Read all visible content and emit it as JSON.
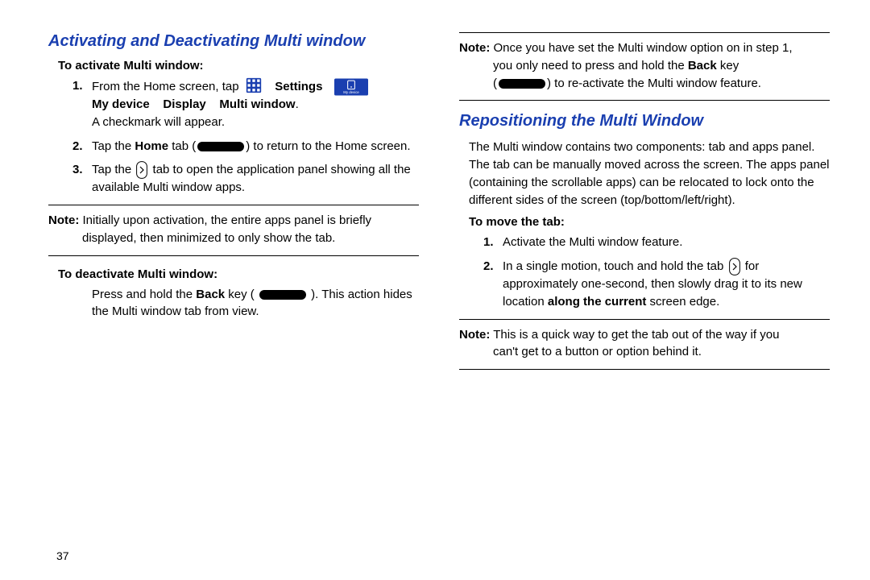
{
  "page_number": "37",
  "left": {
    "heading": "Activating and Deactivating Multi window",
    "activate_sub": "To activate Multi window:",
    "step1_a": "From the Home screen, tap",
    "step1_settings": "Settings",
    "step1_b": "My device",
    "step1_c": "Display",
    "step1_d": "Multi window",
    "step1_dot": ".",
    "step1_after": "A checkmark will appear.",
    "step2_a": "Tap the ",
    "step2_home": "Home",
    "step2_b": " tab (",
    "step2_c": ") to return to the Home screen.",
    "step3_a": "Tap the ",
    "step3_b": " tab to open the application panel showing all the available Multi window apps.",
    "note1_label": "Note:",
    "note1_a": " Initially upon activation, the entire apps panel is briefly",
    "note1_b": "displayed, then minimized to only show the tab.",
    "deactivate_sub": "To deactivate Multi window:",
    "deact_a": "Press and hold the ",
    "deact_back": "Back",
    "deact_b": " key ( ",
    "deact_c": " ). This action hides the Multi window tab from view."
  },
  "right": {
    "note2_label": "Note:",
    "note2_a": " Once you have set the Multi window option on in step 1,",
    "note2_b": "you only need to press and hold the ",
    "note2_back": "Back",
    "note2_c": " key",
    "note2_d": "(",
    "note2_e": ") to re-activate the Multi window feature.",
    "heading": "Repositioning the Multi Window",
    "intro": "The Multi window contains two components: tab and apps panel. The tab can be manually moved across the screen. The apps panel (containing the scrollable apps) can be relocated to lock onto the different sides of the screen (top/bottom/left/right).",
    "move_sub": "To move the tab:",
    "m1": "Activate the Multi window feature.",
    "m2_a": "In a single motion, touch and hold the tab ",
    "m2_b": " for approximately one-second, then slowly drag it to its new location ",
    "m2_bold": "along the current",
    "m2_c": " screen edge.",
    "note3_label": "Note:",
    "note3_a": " This is a quick way to get the tab out of the way if you",
    "note3_b": "can't get to a button or option behind it."
  }
}
